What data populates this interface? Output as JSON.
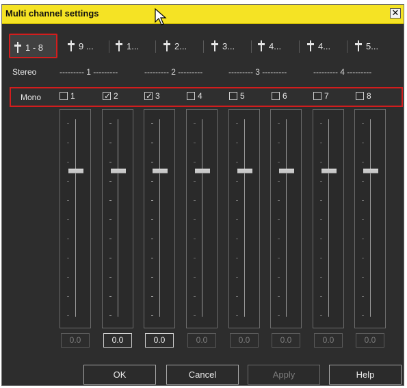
{
  "window": {
    "title": "Multi channel settings",
    "close_glyph": "✕"
  },
  "tabs": [
    {
      "label": "1 - 8",
      "active": true
    },
    {
      "label": "9 ..."
    },
    {
      "label": "1..."
    },
    {
      "label": "2..."
    },
    {
      "label": "3..."
    },
    {
      "label": "4..."
    },
    {
      "label": "4..."
    },
    {
      "label": "5..."
    }
  ],
  "stereo": {
    "label": "Stereo",
    "pairs": [
      "--------- 1 ---------",
      "--------- 2 ---------",
      "--------- 3 ---------",
      "--------- 4 ---------"
    ]
  },
  "mono": {
    "label": "Mono",
    "channels": [
      {
        "label": "1",
        "checked": false
      },
      {
        "label": "2",
        "checked": true
      },
      {
        "label": "3",
        "checked": true
      },
      {
        "label": "4",
        "checked": false
      },
      {
        "label": "5",
        "checked": false
      },
      {
        "label": "6",
        "checked": false
      },
      {
        "label": "7",
        "checked": false
      },
      {
        "label": "8",
        "checked": false
      }
    ]
  },
  "faders": [
    {
      "value": "0.0",
      "active": false
    },
    {
      "value": "0.0",
      "active": true
    },
    {
      "value": "0.0",
      "active": true
    },
    {
      "value": "0.0",
      "active": false
    },
    {
      "value": "0.0",
      "active": false
    },
    {
      "value": "0.0",
      "active": false
    },
    {
      "value": "0.0",
      "active": false
    },
    {
      "value": "0.0",
      "active": false
    }
  ],
  "buttons": {
    "ok": "OK",
    "cancel": "Cancel",
    "apply": "Apply",
    "help": "Help"
  },
  "colors": {
    "title_bar": "#f5e324",
    "highlight": "#d21d1d",
    "dialog_bg": "#2d2d2d"
  }
}
